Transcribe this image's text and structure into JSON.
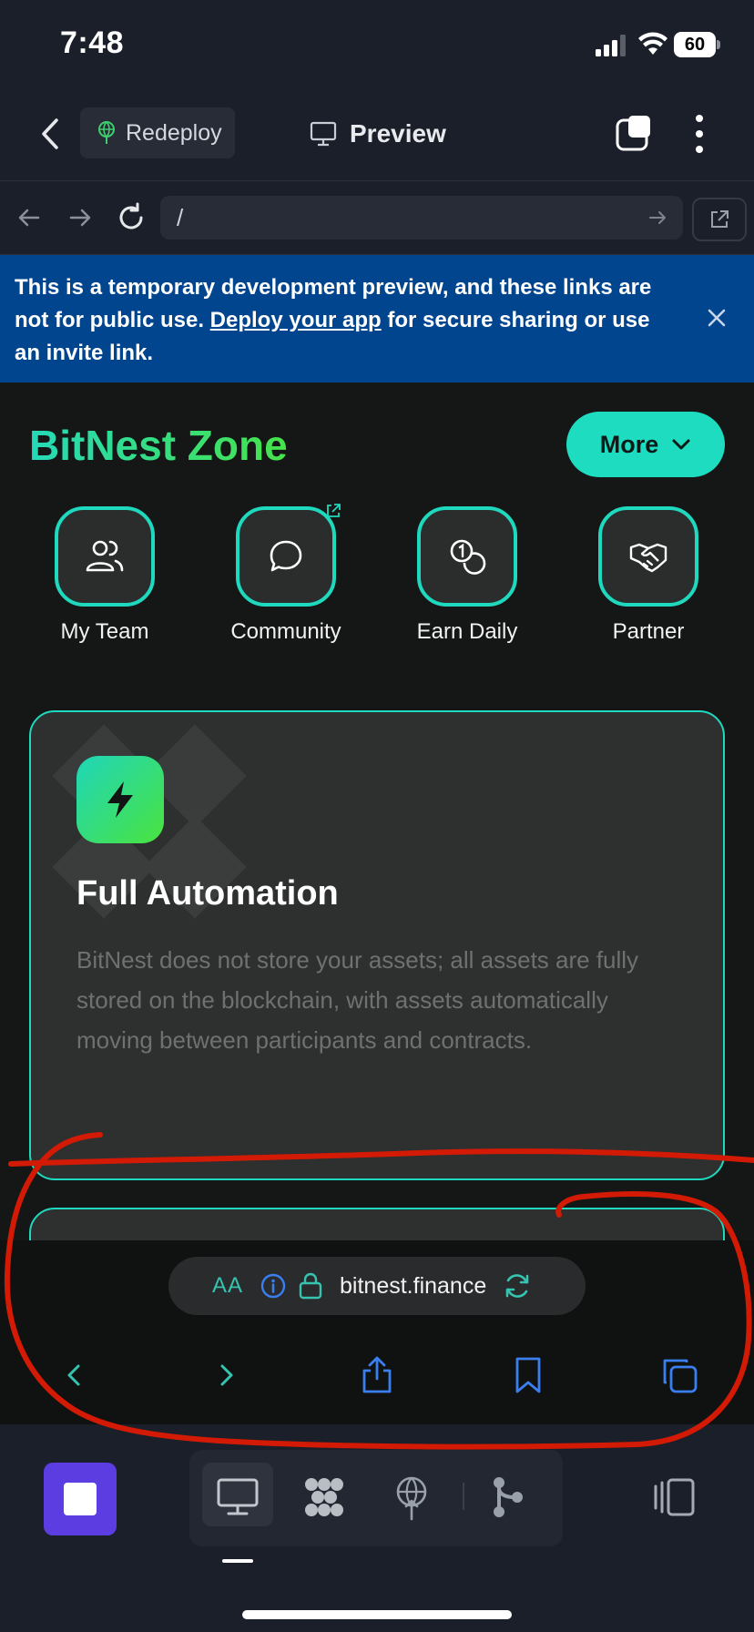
{
  "status_bar": {
    "time": "7:48",
    "battery": "60"
  },
  "header": {
    "redeploy_label": "Redeploy",
    "preview_label": "Preview"
  },
  "url_bar": {
    "path": "/"
  },
  "banner": {
    "text_before": "This is a temporary development preview, and these links are not for public use. ",
    "link": "Deploy your app",
    "text_after": " for secure sharing or use an invite link."
  },
  "site": {
    "brand": "BitNest Zone",
    "more_label": "More",
    "quick_links": [
      {
        "label": "My Team",
        "icon": "users-icon"
      },
      {
        "label": "Community",
        "icon": "chat-bubble-icon"
      },
      {
        "label": "Earn Daily",
        "icon": "coins-icon"
      },
      {
        "label": "Partner",
        "icon": "handshake-icon"
      }
    ],
    "feature": {
      "title": "Full Automation",
      "text": "BitNest does not store your assets; all assets are fully stored on the blockchain, with assets automatically moving between participants and contracts."
    }
  },
  "safari": {
    "aa": "AA",
    "host": "bitnest.finance"
  },
  "colors": {
    "accent": "#1ddcbf",
    "brand_green": "#46e34a",
    "banner_blue": "#02458f",
    "annotation_red": "#d21a05"
  }
}
